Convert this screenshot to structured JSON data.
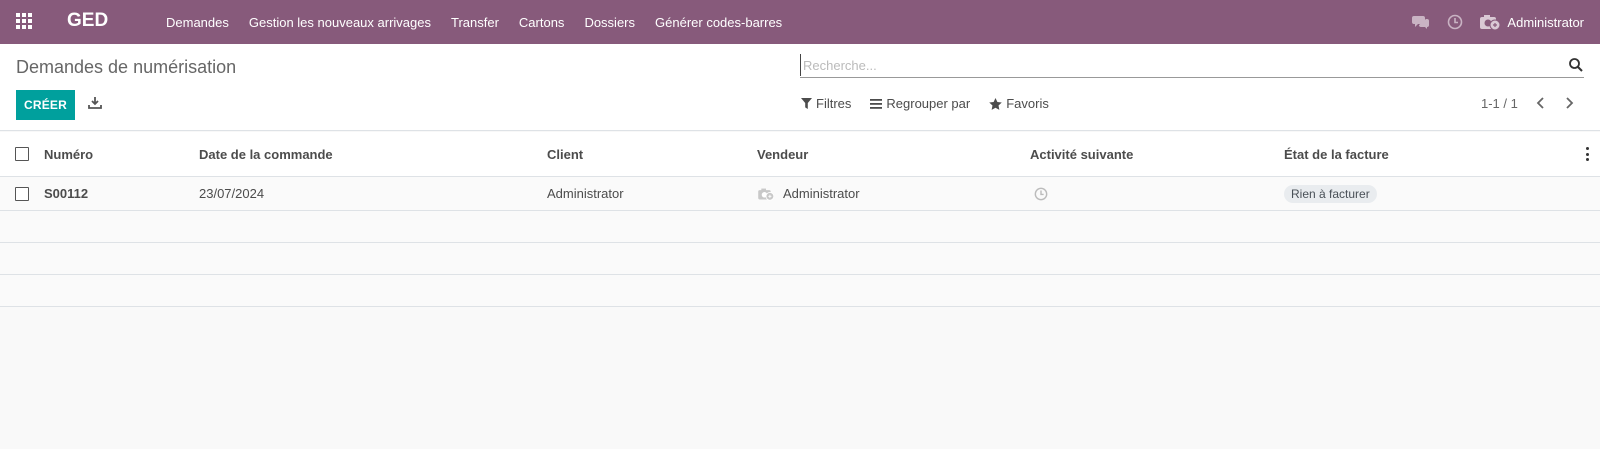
{
  "navbar": {
    "brand": "GED",
    "menu": [
      "Demandes",
      "Gestion les nouveaux arrivages",
      "Transfer",
      "Cartons",
      "Dossiers",
      "Générer codes-barres"
    ],
    "user_name": "Administrator",
    "color": "#875a7b"
  },
  "control_panel": {
    "title": "Demandes de numérisation",
    "search_placeholder": "Recherche...",
    "create_label": "CRÉER",
    "filters_label": "Filtres",
    "group_label": "Regrouper par",
    "favorites_label": "Favoris",
    "pager": "1-1 / 1",
    "create_color": "#00a09d"
  },
  "table": {
    "columns": [
      "Numéro",
      "Date de la commande",
      "Client",
      "Vendeur",
      "Activité suivante",
      "État de la facture"
    ],
    "rows": [
      {
        "numero": "S00112",
        "date": "23/07/2024",
        "client": "Administrator",
        "vendeur": "Administrator",
        "etat": "Rien à facturer"
      }
    ]
  }
}
